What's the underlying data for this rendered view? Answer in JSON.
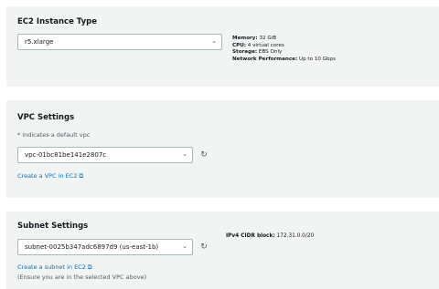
{
  "instance_type": {
    "title": "EC2 Instance Type",
    "selected": "r5.xlarge",
    "specs": [
      {
        "label": "Memory:",
        "value": "32 GiB"
      },
      {
        "label": "CPU:",
        "value": "4 virtual cores"
      },
      {
        "label": "Storage:",
        "value": "EBS Only"
      },
      {
        "label": "Network Performance:",
        "value": "Up to 10 Gbps"
      }
    ]
  },
  "vpc": {
    "title": "VPC Settings",
    "note": "* indicates a default vpc",
    "selected": "vpc-01bc81be141e2807c",
    "create_link": "Create a VPC in EC2"
  },
  "subnet": {
    "title": "Subnet Settings",
    "selected": "subnet-0025b347adc6897d9 (us-east-1b)",
    "cidr_label": "IPv4 CIDR block:",
    "cidr_value": "172.31.0.0/20",
    "create_link": "Create a subnet in EC2",
    "hint": "(Ensure you are in the selected VPC above)"
  },
  "icons": {
    "chevron": "chevron-down-icon",
    "refresh": "refresh-icon",
    "external": "external-link-icon"
  }
}
